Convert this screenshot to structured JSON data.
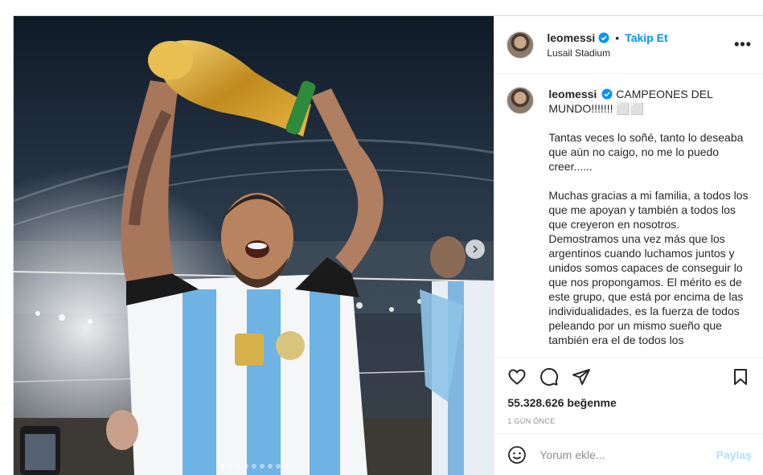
{
  "header": {
    "username": "leomessi",
    "separator": "•",
    "follow_label": "Takip Et",
    "location": "Lusail Stadium",
    "more_label": "•••"
  },
  "caption": {
    "username": "leomessi",
    "headline": "CAMPEONES DEL MUNDO!!!!!!! ⬜⬜",
    "paragraphs": [
      "Tantas veces lo soñé, tanto lo deseaba que aún no caigo, no me lo puedo creer......",
      "Muchas gracias a mi familia, a todos los que me apoyan y también a todos los que creyeron en nosotros. Demostramos una vez más que los argentinos cuando luchamos juntos y unidos somos capaces de conseguir lo que nos propongamos. El mérito es de este grupo, que está por encima de las individualidades, es la fuerza de todos peleando por un mismo sueño que también era el de todos los"
    ]
  },
  "likes": "55.328.626 beğenme",
  "date": "1 GÜN ÖNCE",
  "comment": {
    "placeholder": "Yorum ekle...",
    "share_label": "Paylaş"
  },
  "carousel": {
    "count": 9,
    "active_index": 0
  },
  "icons": {
    "verified": "verified-badge-icon",
    "heart": "heart-icon",
    "comment": "comment-icon",
    "share": "send-icon",
    "bookmark": "bookmark-icon",
    "emoji": "emoji-icon",
    "next": "chevron-right-icon"
  },
  "colors": {
    "accent": "#0095f6",
    "share_disabled": "#b2dffc",
    "text": "#262626",
    "muted": "#8e8e8e"
  }
}
